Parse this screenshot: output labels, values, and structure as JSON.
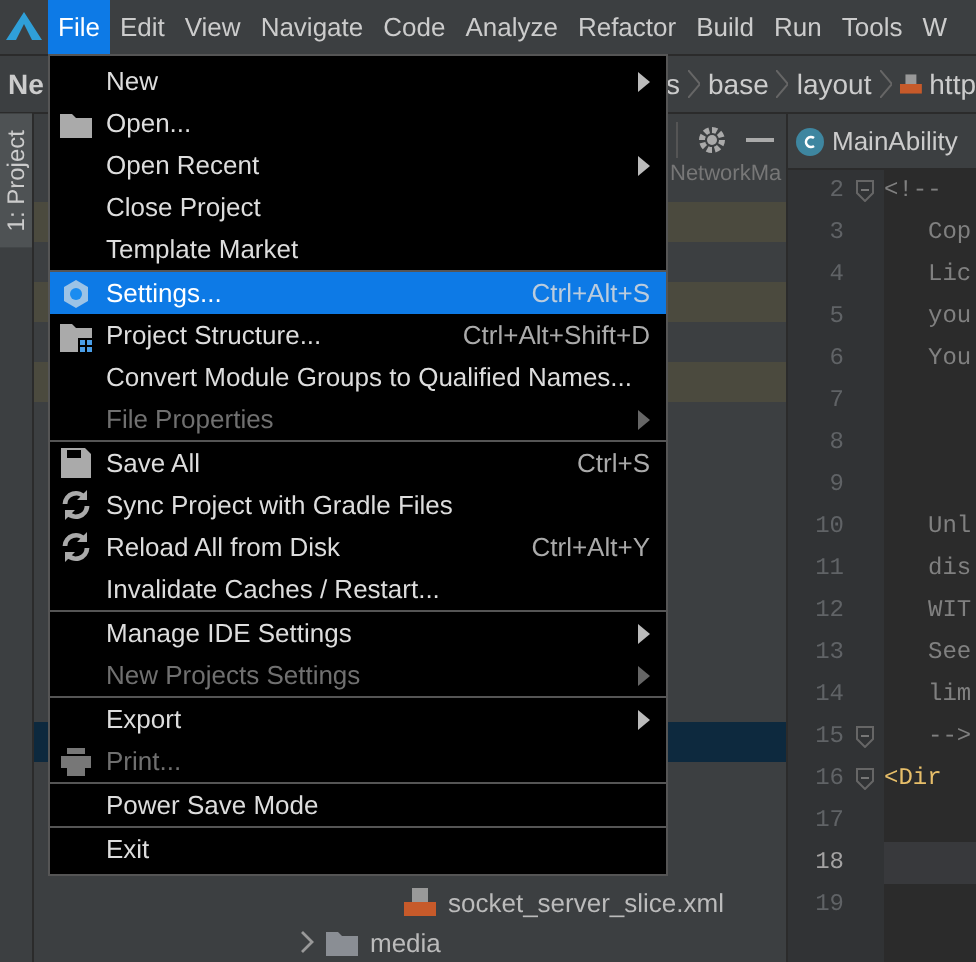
{
  "menubar": {
    "items": [
      {
        "label": "File",
        "selected": true
      },
      {
        "label": "Edit",
        "selected": false
      },
      {
        "label": "View",
        "selected": false
      },
      {
        "label": "Navigate",
        "selected": false
      },
      {
        "label": "Code",
        "selected": false
      },
      {
        "label": "Analyze",
        "selected": false
      },
      {
        "label": "Refactor",
        "selected": false
      },
      {
        "label": "Build",
        "selected": false
      },
      {
        "label": "Run",
        "selected": false
      },
      {
        "label": "Tools",
        "selected": false
      },
      {
        "label": "W",
        "selected": false
      }
    ]
  },
  "breadcrumb": {
    "project": "Ne",
    "items": [
      {
        "label": "s",
        "kind": "plain"
      },
      {
        "label": "base",
        "kind": "plain"
      },
      {
        "label": "layout",
        "kind": "plain"
      },
      {
        "label": "http",
        "kind": "xml"
      }
    ]
  },
  "tool_strip": {
    "label": "1: Project",
    "selected": true
  },
  "project_panel": {
    "header": "NetworkMa",
    "rows": [
      {
        "kind": "modified"
      },
      {
        "kind": "plain"
      },
      {
        "kind": "modified"
      },
      {
        "kind": "plain"
      },
      {
        "kind": "modified"
      },
      {
        "kind": "plain"
      },
      {
        "kind": "plain"
      },
      {
        "kind": "plain"
      },
      {
        "kind": "plain"
      },
      {
        "kind": "plain"
      },
      {
        "kind": "plain"
      },
      {
        "kind": "plain"
      },
      {
        "kind": "plain"
      },
      {
        "kind": "selected"
      },
      {
        "kind": "plain"
      },
      {
        "kind": "plain"
      },
      {
        "kind": "plain"
      },
      {
        "kind": "xml_file",
        "label": "socket_server_slice.xml"
      },
      {
        "kind": "folder",
        "label": "media",
        "expanded": false
      }
    ]
  },
  "editor": {
    "tab": "MainAbility",
    "lines": [
      {
        "number": "2",
        "text": "<!--",
        "kind": "comment",
        "fold": true,
        "current": false
      },
      {
        "number": "3",
        "text": "Cop",
        "kind": "comment",
        "fold": false,
        "current": false
      },
      {
        "number": "4",
        "text": "Lic",
        "kind": "comment",
        "fold": false,
        "current": false
      },
      {
        "number": "5",
        "text": "you",
        "kind": "comment",
        "fold": false,
        "current": false
      },
      {
        "number": "6",
        "text": "You",
        "kind": "comment",
        "fold": false,
        "current": false
      },
      {
        "number": "7",
        "kind": "comment",
        "fold": false,
        "current": false
      },
      {
        "number": "8",
        "kind": "comment",
        "fold": false,
        "current": false
      },
      {
        "number": "9",
        "kind": "comment",
        "fold": false,
        "current": false
      },
      {
        "number": "10",
        "text": "Unl",
        "kind": "comment",
        "fold": false,
        "current": false
      },
      {
        "number": "11",
        "text": "dis",
        "kind": "comment",
        "fold": false,
        "current": false
      },
      {
        "number": "12",
        "text": "WIT",
        "kind": "comment",
        "fold": false,
        "current": false
      },
      {
        "number": "13",
        "text": "See",
        "kind": "comment",
        "fold": false,
        "current": false
      },
      {
        "number": "14",
        "text": "lim",
        "kind": "comment",
        "fold": false,
        "current": false
      },
      {
        "number": "15",
        "text": "-->",
        "kind": "comment",
        "fold": true,
        "current": false
      },
      {
        "number": "16",
        "text": "<Dir",
        "kind": "tag",
        "fold": true,
        "current": false
      },
      {
        "number": "17",
        "kind": "comment",
        "fold": false,
        "current": false
      },
      {
        "number": "18",
        "kind": "comment",
        "fold": false,
        "current": true
      },
      {
        "number": "19",
        "kind": "comment",
        "fold": false,
        "current": false
      }
    ]
  },
  "menu": {
    "groups": [
      [
        {
          "label": "New",
          "kind": "plain",
          "submenu": true,
          "disabled": false,
          "selected": false
        },
        {
          "label": "Open...",
          "kind": "folder",
          "submenu": false,
          "disabled": false,
          "selected": false
        },
        {
          "label": "Open Recent",
          "kind": "plain",
          "submenu": true,
          "disabled": false,
          "selected": false
        },
        {
          "label": "Close Project",
          "kind": "plain",
          "submenu": false,
          "disabled": false,
          "selected": false
        },
        {
          "label": "Template Market",
          "kind": "plain",
          "submenu": false,
          "disabled": false,
          "selected": false
        }
      ],
      [
        {
          "label": "Settings...",
          "kind": "gear",
          "shortcut": "Ctrl+Alt+S",
          "submenu": false,
          "disabled": false,
          "selected": true
        },
        {
          "label": "Project Structure...",
          "kind": "structure",
          "shortcut": "Ctrl+Alt+Shift+D",
          "submenu": false,
          "disabled": false,
          "selected": false
        },
        {
          "label": "Convert Module Groups to Qualified Names...",
          "kind": "plain",
          "submenu": false,
          "disabled": false,
          "selected": false
        },
        {
          "label": "File Properties",
          "kind": "plain",
          "submenu": true,
          "disabled": true,
          "selected": false
        }
      ],
      [
        {
          "label": "Save All",
          "kind": "save",
          "shortcut": "Ctrl+S",
          "submenu": false,
          "disabled": false,
          "selected": false
        },
        {
          "label": "Sync Project with Gradle Files",
          "kind": "sync",
          "submenu": false,
          "disabled": false,
          "selected": false
        },
        {
          "label": "Reload All from Disk",
          "kind": "sync",
          "shortcut": "Ctrl+Alt+Y",
          "submenu": false,
          "disabled": false,
          "selected": false
        },
        {
          "label": "Invalidate Caches / Restart...",
          "kind": "plain",
          "submenu": false,
          "disabled": false,
          "selected": false
        }
      ],
      [
        {
          "label": "Manage IDE Settings",
          "kind": "plain",
          "submenu": true,
          "disabled": false,
          "selected": false
        },
        {
          "label": "New Projects Settings",
          "kind": "plain",
          "submenu": true,
          "disabled": true,
          "selected": false
        }
      ],
      [
        {
          "label": "Export",
          "kind": "plain",
          "submenu": true,
          "disabled": false,
          "selected": false
        },
        {
          "label": "Print...",
          "kind": "printer",
          "submenu": false,
          "disabled": true,
          "selected": false
        }
      ],
      [
        {
          "label": "Power Save Mode",
          "kind": "plain",
          "submenu": false,
          "disabled": false,
          "selected": false
        }
      ],
      [
        {
          "label": "Exit",
          "kind": "plain",
          "submenu": false,
          "disabled": false,
          "selected": false
        }
      ]
    ]
  }
}
